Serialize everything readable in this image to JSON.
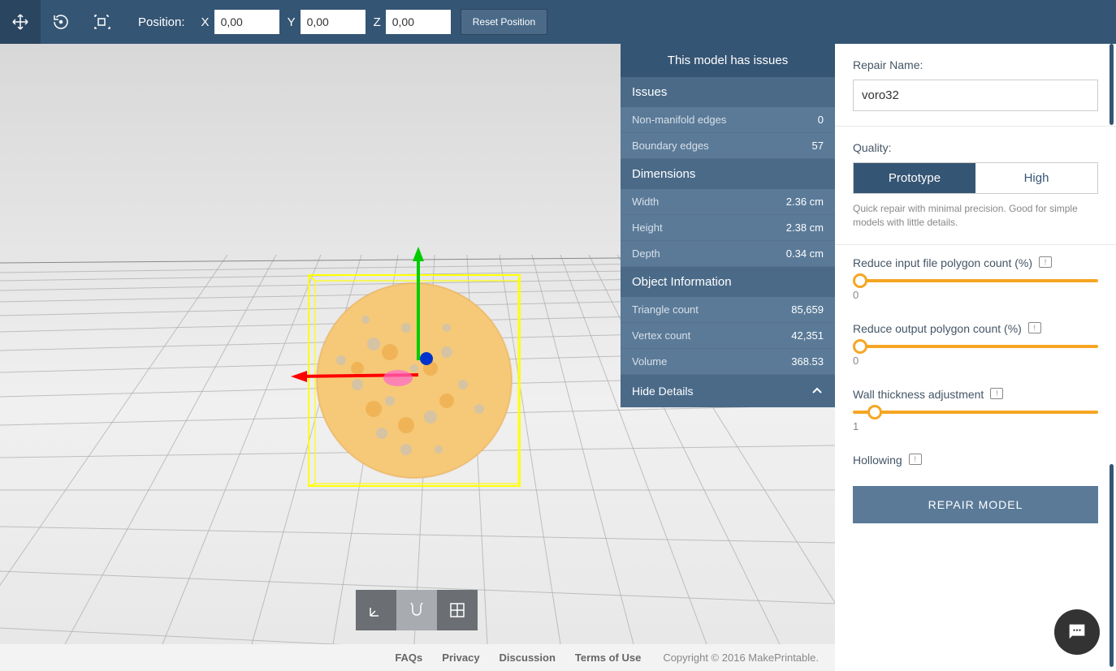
{
  "toolbar": {
    "position_label": "Position:",
    "x_label": "X",
    "x_value": "0,00",
    "y_label": "Y",
    "y_value": "0,00",
    "z_label": "Z",
    "z_value": "0,00",
    "reset": "Reset Position"
  },
  "issues": {
    "title": "This model has issues",
    "sections": [
      {
        "header": "Issues",
        "rows": [
          {
            "label": "Non-manifold edges",
            "value": "0"
          },
          {
            "label": "Boundary edges",
            "value": "57"
          }
        ]
      },
      {
        "header": "Dimensions",
        "rows": [
          {
            "label": "Width",
            "value": "2.36 cm"
          },
          {
            "label": "Height",
            "value": "2.38 cm"
          },
          {
            "label": "Depth",
            "value": "0.34 cm"
          }
        ]
      },
      {
        "header": "Object Information",
        "rows": [
          {
            "label": "Triangle count",
            "value": "85,659"
          },
          {
            "label": "Vertex count",
            "value": "42,351"
          },
          {
            "label": "Volume",
            "value": "368.53"
          }
        ]
      }
    ],
    "hide": "Hide Details"
  },
  "right": {
    "repair_name_label": "Repair Name:",
    "repair_name_value": "voro32",
    "quality_label": "Quality:",
    "quality_prototype": "Prototype",
    "quality_high": "High",
    "quality_desc": "Quick repair with minimal precision. Good for simple models with little details.",
    "sliders": [
      {
        "label": "Reduce input file polygon count (%)",
        "value": "0",
        "pos": 0
      },
      {
        "label": "Reduce output polygon count (%)",
        "value": "0",
        "pos": 0
      },
      {
        "label": "Wall thickness adjustment",
        "value": "1",
        "pos": 6
      }
    ],
    "hollowing": "Hollowing",
    "repair_button": "REPAIR MODEL"
  },
  "footer": {
    "faqs": "FAQs",
    "privacy": "Privacy",
    "discussion": "Discussion",
    "terms": "Terms of Use",
    "copyright": "Copyright © 2016 MakePrintable."
  }
}
